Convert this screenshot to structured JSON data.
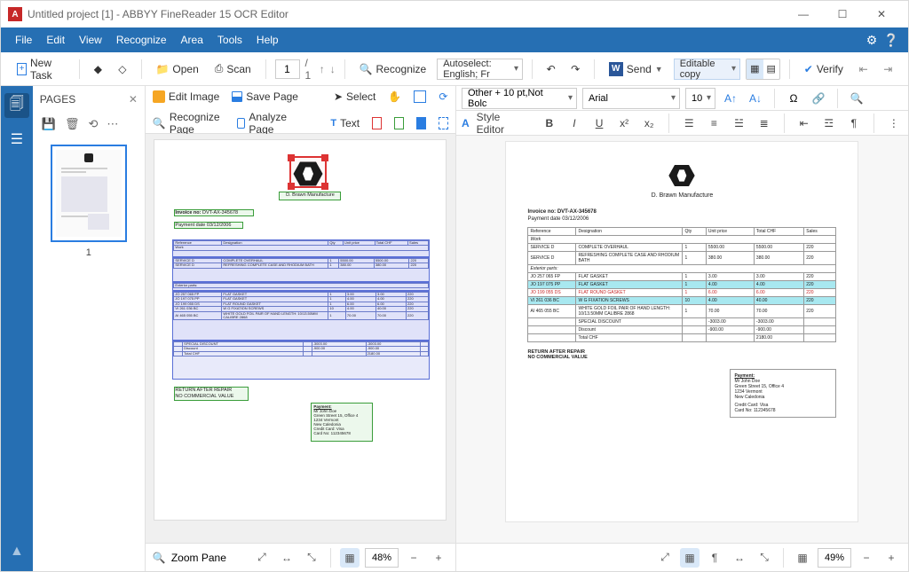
{
  "window": {
    "title": "Untitled project [1] - ABBYY FineReader 15 OCR Editor"
  },
  "menu": {
    "file": "File",
    "edit": "Edit",
    "view": "View",
    "recognize": "Recognize",
    "area": "Area",
    "tools": "Tools",
    "help": "Help"
  },
  "toolbar": {
    "new_task": "New Task",
    "open": "Open",
    "scan": "Scan",
    "page_current": "1",
    "page_total": "/ 1",
    "recognize": "Recognize",
    "lang": "Autoselect: English; Fr",
    "send": "Send",
    "mode": "Editable copy",
    "verify": "Verify"
  },
  "pages": {
    "title": "PAGES",
    "thumb_number": "1"
  },
  "img_tools": {
    "edit_image": "Edit Image",
    "save_page": "Save Page",
    "recognize_page": "Recognize Page",
    "analyze_page": "Analyze Page",
    "select": "Select",
    "text": "Text",
    "zoom_pane": "Zoom Pane",
    "zoom": "48%"
  },
  "text_tools": {
    "style_combo": "Other + 10 pt,Not Bolc",
    "font": "Arial",
    "size": "10",
    "style_editor": "Style Editor",
    "zoom": "49%"
  },
  "doc": {
    "brand": "D. Brawn Manufacture",
    "invoice_no_label": "Invoice no:",
    "invoice_no": "DVT-AX-345678",
    "payment_date_label": "Payment date",
    "payment_date": "03/12/2006",
    "headers": {
      "ref": "Reference",
      "desig": "Designation",
      "qty": "Qty",
      "price": "Unit price",
      "total": "Total CHF",
      "sales": "Sales"
    },
    "sections": {
      "work": "Work",
      "exterior": "Exterior parts:"
    },
    "work_rows": [
      {
        "ref": "SERVICE D",
        "desig": "COMPLETE OVERHAUL",
        "qty": "1",
        "price": "5500.00",
        "total": "5500.00",
        "sales": "220"
      },
      {
        "ref": "SERVICE D",
        "desig": "REFRESHING COMPLETE CASE AND RHODIUM BATH",
        "qty": "1",
        "price": "380.00",
        "total": "380.00",
        "sales": "220"
      }
    ],
    "ext_rows": [
      {
        "ref": "JO 257 065 FP",
        "desig": "FLAT GASKET",
        "qty": "1",
        "price": "3.00",
        "total": "3.00",
        "sales": "220"
      },
      {
        "ref": "JO 197 075 PP",
        "desig": "FLAT GASKET",
        "qty": "1",
        "price": "4.00",
        "total": "4.00",
        "sales": "220"
      },
      {
        "ref": "JO 199 055 DS",
        "desig": "FLAT ROUND GASKET",
        "qty": "1",
        "price": "6.00",
        "total": "6.00",
        "sales": "220"
      },
      {
        "ref": "VI 261 036 BC",
        "desig": "W G FIXATION SCREWS",
        "qty": "10",
        "price": "4.00",
        "total": "40.00",
        "sales": "220"
      },
      {
        "ref": "AI 465 055 BC",
        "desig": "WHITE GOLD FOIL PAIR OF HAND LENGTH: 10/13.50MM CALIBRE 2868",
        "qty": "1",
        "price": "70.00",
        "total": "70.00",
        "sales": "220"
      }
    ],
    "specials": [
      {
        "label": "SPECIAL DISCOUNT",
        "c1": "-3003.00",
        "c2": "-3003.00"
      },
      {
        "label": "Discount",
        "c1": "-900.00",
        "c2": "-900.00"
      },
      {
        "label": "Total CHF",
        "c1": "",
        "c2": "2180.00"
      }
    ],
    "return_after": "RETURN AFTER REPAIR",
    "no_commercial": "NO COMMERCIAL VALUE",
    "payment_block": {
      "title": "Payment:",
      "l1": "Mr John Doe",
      "l2": "Green Street 15, Office 4",
      "l3": "1234 Vermont",
      "l4": "New Caledonia",
      "l5": "Credit Card: Visa",
      "l6": "Card No: 112345678"
    }
  }
}
